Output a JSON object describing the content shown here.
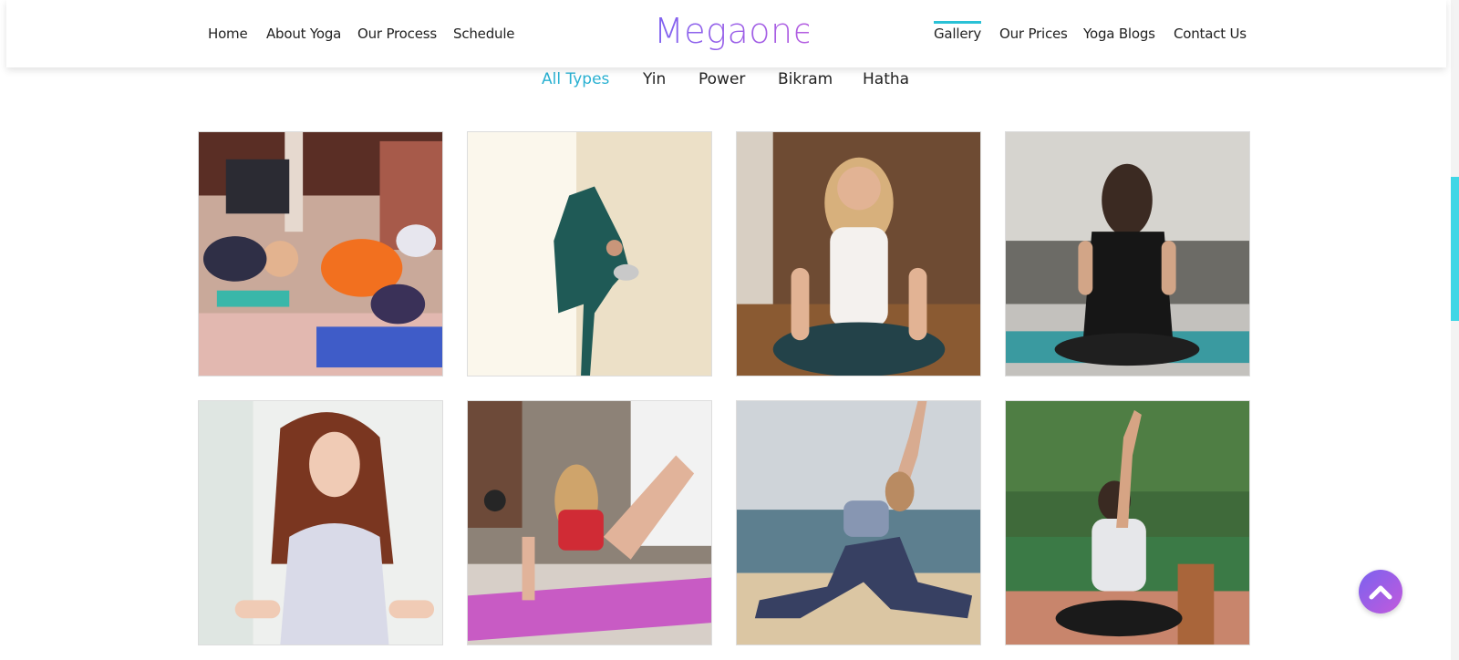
{
  "brand": {
    "logo_text": "Megaone"
  },
  "nav_left": [
    {
      "label": "Home"
    },
    {
      "label": "About Yoga"
    },
    {
      "label": "Our Process"
    },
    {
      "label": "Schedule"
    }
  ],
  "nav_right": [
    {
      "label": "Gallery",
      "active": true
    },
    {
      "label": "Our Prices"
    },
    {
      "label": "Yoga Blogs"
    },
    {
      "label": "Contact Us"
    }
  ],
  "filters": [
    {
      "label": "All Types",
      "active": true
    },
    {
      "label": "Yin"
    },
    {
      "label": "Power"
    },
    {
      "label": "Bikram"
    },
    {
      "label": "Hatha"
    }
  ],
  "colors": {
    "accent": "#2ab1d2",
    "logo_gradient_start": "#7f63f0",
    "logo_gradient_end": "#b45de0",
    "scroll_thumb": "#40d6e6"
  },
  "gallery": [
    {
      "icon": "class-side-stretch-photo"
    },
    {
      "icon": "dancer-pose-photo"
    },
    {
      "icon": "seated-meditation-photo"
    },
    {
      "icon": "reverse-prayer-photo"
    },
    {
      "icon": "redhead-meditation-photo"
    },
    {
      "icon": "kickback-class-photo"
    },
    {
      "icon": "beach-lunge-photo"
    },
    {
      "icon": "eagle-arms-outdoor-photo"
    }
  ],
  "back_to_top": {
    "icon": "chevron-up-icon"
  }
}
